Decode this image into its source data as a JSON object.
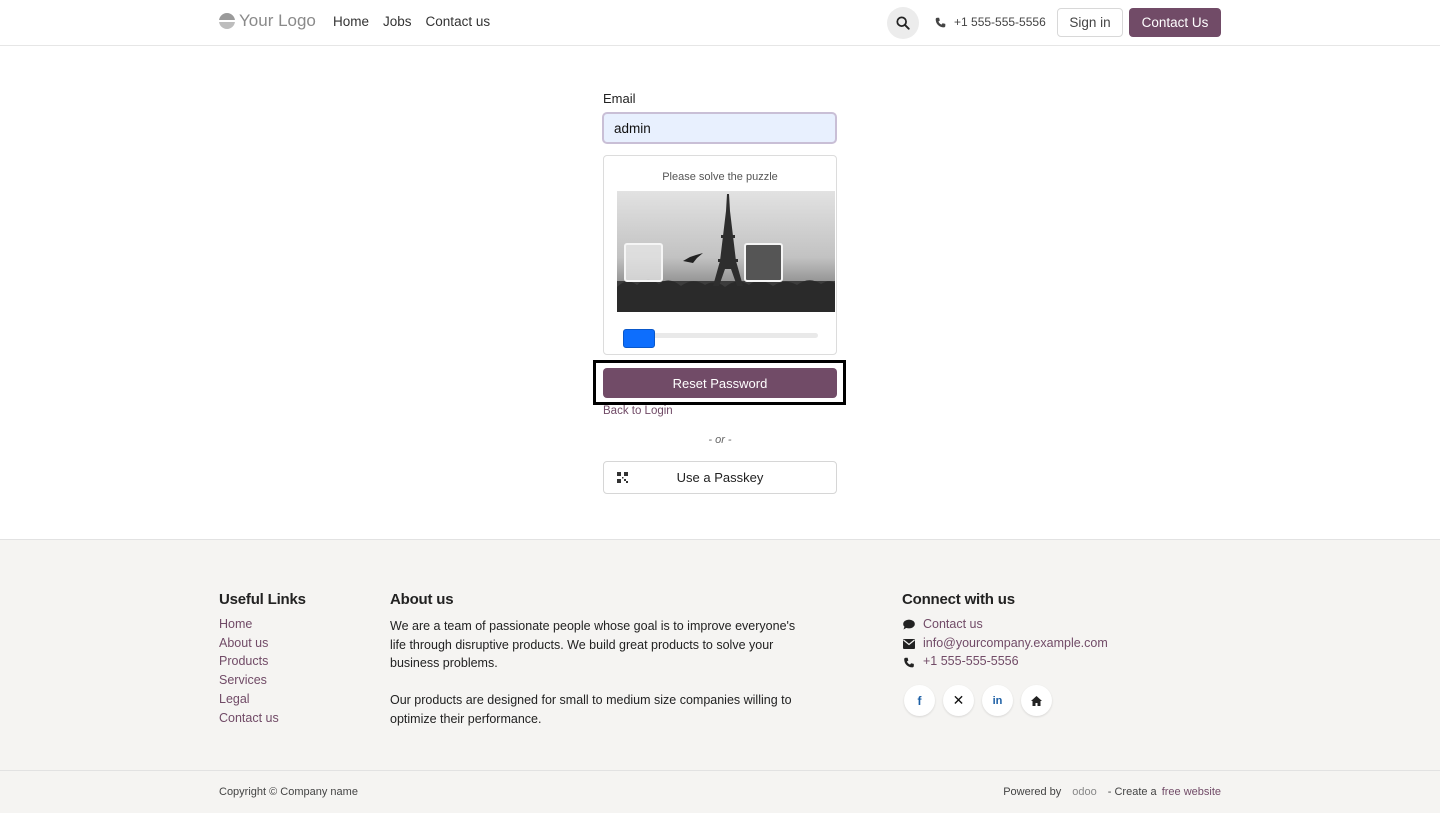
{
  "header": {
    "logo_text": "Your Logo",
    "nav": [
      "Home",
      "Jobs",
      "Contact us"
    ],
    "phone": "+1 555-555-5556",
    "signin_label": "Sign in",
    "contact_label": "Contact Us"
  },
  "form": {
    "email_label": "Email",
    "email_value": "admin",
    "puzzle_title": "Please solve the puzzle",
    "slider_position": 0,
    "reset_label": "Reset Password",
    "back_label": "Back to Login",
    "or_label": "- or -",
    "passkey_label": "Use a Passkey"
  },
  "footer": {
    "useful_links_title": "Useful Links",
    "useful_links": [
      "Home",
      "About us",
      "Products",
      "Services",
      "Legal",
      "Contact us"
    ],
    "about_title": "About us",
    "about_p1": "We are a team of passionate people whose goal is to improve everyone's life through disruptive products. We build great products to solve your business problems.",
    "about_p2": "Our products are designed for small to medium size companies willing to optimize their performance.",
    "connect_title": "Connect with us",
    "connect_contact": "Contact us",
    "connect_email": "info@yourcompany.example.com",
    "connect_phone": "+1 555-555-5556",
    "social": [
      "facebook-icon",
      "x-icon",
      "linkedin-icon",
      "home-icon"
    ],
    "copyright": "Copyright © Company name",
    "powered_by": "Powered by",
    "odoo": "odoo",
    "create_prefix": "- Create a",
    "create_link": "free website"
  },
  "colors": {
    "brand": "#714b67",
    "slider": "#0d6efd"
  }
}
